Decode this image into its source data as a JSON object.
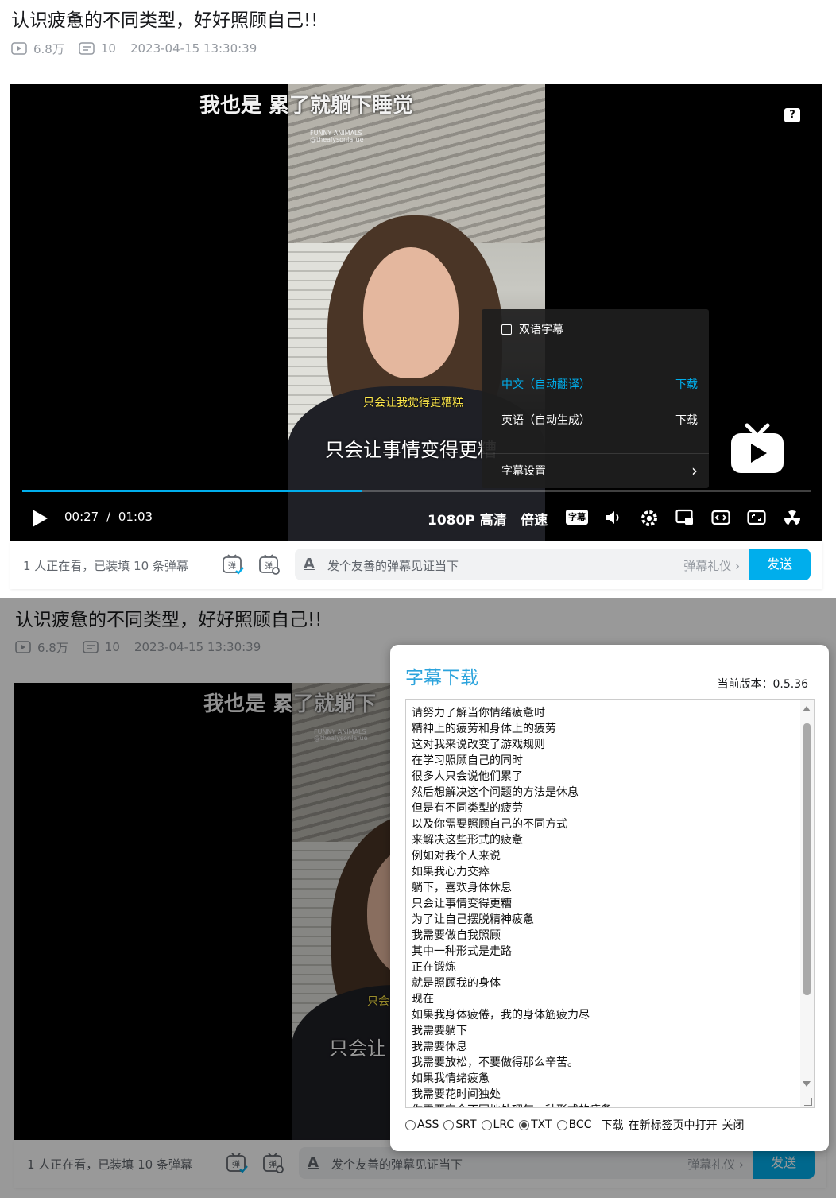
{
  "video": {
    "title": "认识疲惫的不同类型，好好照顾自己!!",
    "plays": "6.8万",
    "danmaku_count": "10",
    "published": "2023-04-15 13:30:39"
  },
  "player": {
    "top_caption": "我也是 累了就躺下睡觉",
    "top_caption_cut": "我也是 累了就躺下",
    "watermark_line1": "FUNNY ANIMALS",
    "watermark_line2": "@thealysonlarue",
    "subtitle_small": "只会让我觉得更糟糕",
    "subtitle_big": "只会让事情变得更糟",
    "subtitle_big_cut": "只会让",
    "subtitle_small_cut": "只会",
    "help": "?",
    "time_current": "00:27",
    "time_sep": "/",
    "time_total": "01:03",
    "progress_fraction": 0.43,
    "quality": "1080P 高清",
    "speed": "倍速",
    "subtitle_badge": "字幕"
  },
  "subtitle_menu": {
    "bilingual": "双语字幕",
    "tracks": [
      {
        "label": "中文（自动翻译）",
        "action": "下载",
        "active": true
      },
      {
        "label": "英语（自动生成）",
        "action": "下载",
        "active": false
      }
    ],
    "settings": "字幕设置",
    "settings_arrow": "›"
  },
  "sendbar": {
    "viewers": "1 人正在看，已装填 10 条弹幕",
    "placeholder": "发个友善的弹幕见证当下",
    "etiquette": "弹幕礼仪 ›",
    "send": "发送"
  },
  "dialog": {
    "title": "字幕下载",
    "version": "当前版本：0.5.36",
    "lines": [
      "请努力了解当你情绪疲惫时",
      "精神上的疲劳和身体上的疲劳",
      "这对我来说改变了游戏规则",
      "在学习照顾自己的同时",
      "很多人只会说他们累了",
      "然后想解决这个问题的方法是休息",
      "但是有不同类型的疲劳",
      "以及你需要照顾自己的不同方式",
      "来解决这些形式的疲惫",
      "例如对我个人来说",
      "如果我心力交瘁",
      "躺下，喜欢身体休息",
      "只会让事情变得更糟",
      "为了让自己摆脱精神疲惫",
      "我需要做自我照顾",
      "其中一种形式是走路",
      "正在锻炼",
      "就是照顾我的身体",
      "现在",
      "如果我身体疲倦，我的身体筋疲力尽",
      "我需要躺下",
      "我需要休息",
      "我需要放松，不要做得那么辛苦。",
      "如果我情绪疲惫",
      "我需要花时间独处",
      "你需要完全不同地处理每一种形式的疲惫"
    ],
    "formats": [
      {
        "label": "ASS",
        "selected": false
      },
      {
        "label": "SRT",
        "selected": false
      },
      {
        "label": "LRC",
        "selected": false
      },
      {
        "label": "TXT",
        "selected": true
      },
      {
        "label": "BCC",
        "selected": false
      }
    ],
    "download": "下载",
    "open_new_tab": "在新标签页中打开",
    "close": "关闭"
  },
  "colors": {
    "accent": "#00aeec",
    "dialog_title": "#2ba3dc",
    "subtitle_yellow": "#ffe94a"
  }
}
